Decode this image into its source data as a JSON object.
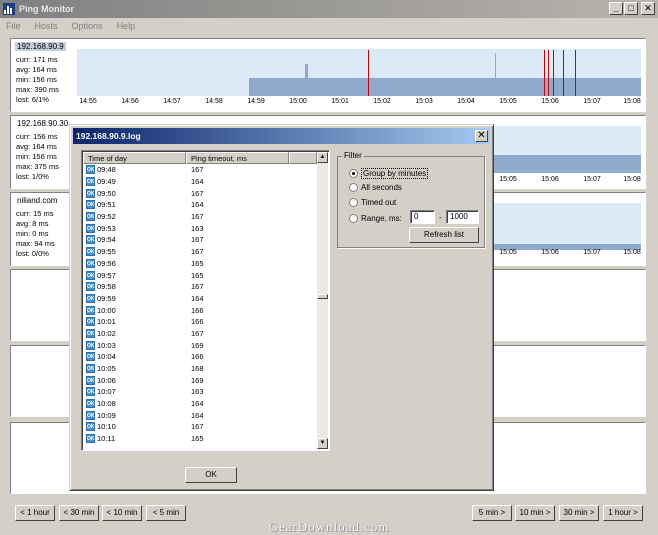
{
  "window": {
    "title": "Ping Monitor",
    "controls": {
      "minimize": "_",
      "maximize": "□",
      "close": "✕"
    }
  },
  "menu": [
    "File",
    "Hosts",
    "Options",
    "Help"
  ],
  "hosts": [
    {
      "name": "192.168.90.9",
      "curr": "curr: 171 ms",
      "avg": "avg: 164 ms",
      "min": "min: 156 ms",
      "max": "max: 390 ms",
      "lost": "lost: 6/1%"
    },
    {
      "name": "192.168.90.30",
      "curr": "curr: 156 ms",
      "avg": "avg: 164 ms",
      "min": "min: 156 ms",
      "max": "max: 375 ms",
      "lost": "lost: 1/0%"
    },
    {
      "name": "niliand.com",
      "curr": "curr: 15 ms",
      "avg": "avg: 8 ms",
      "min": "min: 0 ms",
      "max": "max: 94 ms",
      "lost": "lost: 0/0%"
    }
  ],
  "time_ticks_full": [
    "14:55",
    "14:56",
    "14:57",
    "14:58",
    "14:59",
    "15:00",
    "15:01",
    "15:02",
    "15:03",
    "15:04",
    "15:05",
    "15:06",
    "15:07",
    "15:08"
  ],
  "time_ticks_partial": [
    "15:05",
    "15:06",
    "15:07",
    "15:08"
  ],
  "nav": {
    "back": [
      "< 1 hour",
      "< 30 min",
      "< 10 min",
      "< 5 min"
    ],
    "forward": [
      "5 min >",
      "10 min >",
      "30 min >",
      "1 hour >"
    ]
  },
  "watermark": "GearDownload.com",
  "dialog": {
    "title": "192.168.90.9.log",
    "close": "✕",
    "columns": [
      "Time of day",
      "Ping timeout, ms"
    ],
    "status_icon": "OK",
    "rows": [
      {
        "time": "09:48",
        "ms": "167"
      },
      {
        "time": "09:49",
        "ms": "164"
      },
      {
        "time": "09:50",
        "ms": "167"
      },
      {
        "time": "09:51",
        "ms": "164"
      },
      {
        "time": "09:52",
        "ms": "167"
      },
      {
        "time": "09:53",
        "ms": "163"
      },
      {
        "time": "09:54",
        "ms": "167"
      },
      {
        "time": "09:55",
        "ms": "167"
      },
      {
        "time": "09:56",
        "ms": "165"
      },
      {
        "time": "09:57",
        "ms": "165"
      },
      {
        "time": "09:58",
        "ms": "167"
      },
      {
        "time": "09:59",
        "ms": "164"
      },
      {
        "time": "10:00",
        "ms": "166"
      },
      {
        "time": "10:01",
        "ms": "166"
      },
      {
        "time": "10:02",
        "ms": "167"
      },
      {
        "time": "10:03",
        "ms": "169"
      },
      {
        "time": "10:04",
        "ms": "166"
      },
      {
        "time": "10:05",
        "ms": "168"
      },
      {
        "time": "10:06",
        "ms": "169"
      },
      {
        "time": "10:07",
        "ms": "163"
      },
      {
        "time": "10:08",
        "ms": "164"
      },
      {
        "time": "10:09",
        "ms": "164"
      },
      {
        "time": "10:10",
        "ms": "167"
      },
      {
        "time": "10:11",
        "ms": "165"
      }
    ],
    "filter": {
      "label": "Filter",
      "options": [
        "Group by minutes",
        "All seconds",
        "Timed out",
        "Range, ms:"
      ],
      "selected": "Group by minutes",
      "range_from": "0",
      "range_sep": "-",
      "range_to": "1000",
      "refresh_label": "Refresh list"
    },
    "ok_label": "OK"
  }
}
